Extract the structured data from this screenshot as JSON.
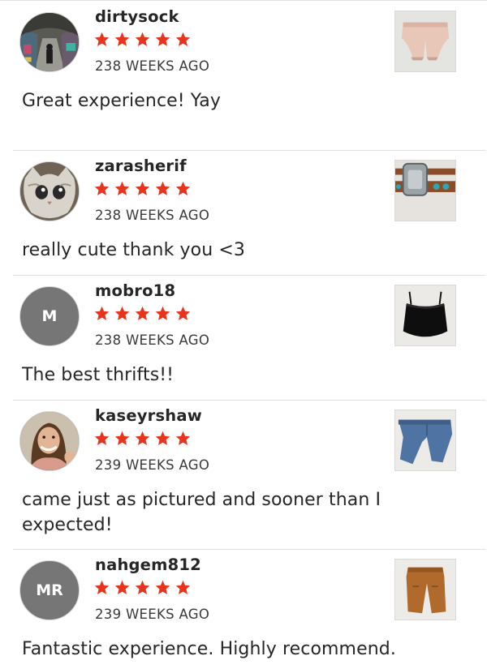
{
  "reviews": [
    {
      "username": "dirtysock",
      "rating": 5,
      "time": "238 WEEKS AGO",
      "text": "Great experience! Yay",
      "avatar_icon": "graffiti-tunnel-photo",
      "item_icon": "pink-shorts-photo"
    },
    {
      "username": "zarasherif",
      "rating": 5,
      "time": "238 WEEKS AGO",
      "text": "really cute thank you <3",
      "avatar_icon": "cat-photo",
      "item_icon": "western-belt-photo"
    },
    {
      "username": "mobro18",
      "rating": 5,
      "time": "238 WEEKS AGO",
      "text": "The best thrifts!!",
      "avatar_initials": "M",
      "item_icon": "black-corset-top-photo"
    },
    {
      "username": "kaseyrshaw",
      "rating": 5,
      "time": "239 WEEKS AGO",
      "text": "came just as pictured and sooner than I expected!",
      "avatar_icon": "smiling-woman-photo",
      "item_icon": "blue-jeans-photo"
    },
    {
      "username": "nahgem812",
      "rating": 5,
      "time": "239 WEEKS AGO",
      "text": "Fantastic experience. Highly recommend.",
      "avatar_initials": "MR",
      "item_icon": "brown-pants-photo"
    }
  ],
  "colors": {
    "star": "#e8341c",
    "avatar_bg": "#767676",
    "text": "#262626",
    "separator": "#dedede"
  }
}
